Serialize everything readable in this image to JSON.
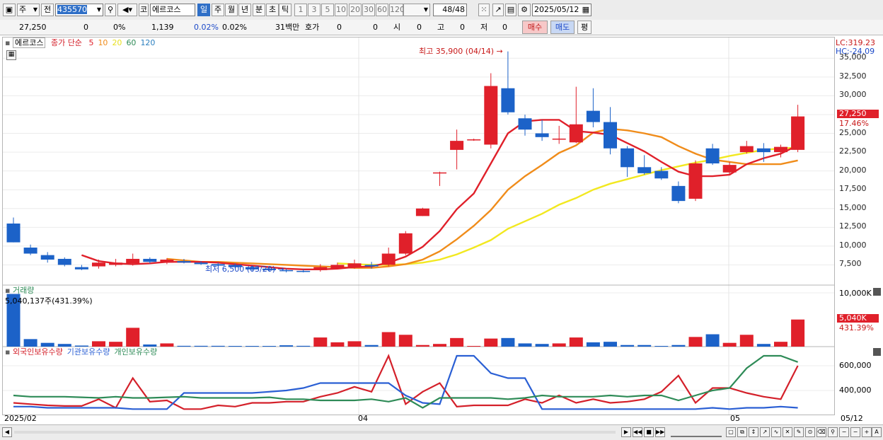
{
  "toolbar": {
    "market_label": "주",
    "all_label": "전",
    "stock_code": "435570",
    "exchange_label": "코",
    "stock_name": "에르코스",
    "period_tabs": [
      "일",
      "주",
      "월",
      "년",
      "분",
      "초",
      "틱"
    ],
    "period_selected": 0,
    "minute_presets": [
      "1",
      "3",
      "5",
      "10",
      "20",
      "30",
      "60",
      "120"
    ],
    "page_count": "48/48",
    "date": "2025/05/12"
  },
  "info": {
    "price": "27,250",
    "change": "0",
    "change_pct": "0%",
    "volume": "1,139",
    "pct1": "0.02%",
    "pct2": "0.02%",
    "amount": "31백만",
    "quote_label": "호가",
    "quote1": "0",
    "quote2": "0",
    "open_label": "시",
    "open_val": "0",
    "high_label": "고",
    "high_val": "0",
    "low_label": "저",
    "low_val": "0",
    "buy_label": "매수",
    "sell_label": "매도",
    "avg_label": "평"
  },
  "price_panel": {
    "legend_name": "에르코스",
    "legend_ma_title": "종가 단순",
    "ma_periods": [
      "5",
      "10",
      "20",
      "60",
      "120"
    ],
    "ma_colors": [
      "#e0202a",
      "#f08c1a",
      "#e8e020",
      "#2e8b57",
      "#2a7fbf"
    ],
    "high_annotation": "최고 35,900 (04/14)",
    "low_annotation": "최저 6,500 (03/20)",
    "lc_label": "LC:319.23",
    "hc_label": "HC:-24.09",
    "current_price_tag": "27,250",
    "current_pct_tag": "17.46%",
    "y_ticks": [
      "35,000",
      "32,500",
      "30,000",
      "27,500",
      "25,000",
      "22,500",
      "20,000",
      "17,500",
      "15,000",
      "12,500",
      "10,000",
      "7,500"
    ]
  },
  "volume_panel": {
    "title": "거래량",
    "current_label": "5,040,137주(431.39%)",
    "max_tick": "10,000K",
    "current_tag": "5,040K",
    "current_pct_tag": "431.39%"
  },
  "holdings_panel": {
    "legend": [
      "외국인보유수량",
      "기관보유수량",
      "개인보유수량"
    ],
    "colors": [
      "#d4202a",
      "#2a5fd4",
      "#2e8b57"
    ],
    "y_ticks": [
      "600,000",
      "400,000"
    ]
  },
  "x_axis": {
    "labels": [
      "2025/02",
      "04",
      "05"
    ],
    "right_label": "05/12"
  },
  "chart_data": {
    "type": "candlestick",
    "ylim": [
      5000,
      37000
    ],
    "candles": [
      {
        "o": 13000,
        "h": 13800,
        "l": 10500,
        "c": 10500
      },
      {
        "o": 9800,
        "h": 10200,
        "l": 8800,
        "c": 9000
      },
      {
        "o": 8800,
        "h": 9200,
        "l": 7800,
        "c": 8200
      },
      {
        "o": 8300,
        "h": 8500,
        "l": 7300,
        "c": 7500
      },
      {
        "o": 7200,
        "h": 7500,
        "l": 6800,
        "c": 6900
      },
      {
        "o": 7300,
        "h": 8200,
        "l": 7000,
        "c": 7800
      },
      {
        "o": 7500,
        "h": 8300,
        "l": 7300,
        "c": 7800
      },
      {
        "o": 7700,
        "h": 9000,
        "l": 7400,
        "c": 8300
      },
      {
        "o": 8300,
        "h": 8500,
        "l": 7700,
        "c": 7900
      },
      {
        "o": 7800,
        "h": 8400,
        "l": 7600,
        "c": 8200
      },
      {
        "o": 8000,
        "h": 8300,
        "l": 7700,
        "c": 7800
      },
      {
        "o": 7800,
        "h": 8000,
        "l": 7500,
        "c": 7600
      },
      {
        "o": 7600,
        "h": 7800,
        "l": 7300,
        "c": 7400
      },
      {
        "o": 7500,
        "h": 7700,
        "l": 7000,
        "c": 7200
      },
      {
        "o": 7200,
        "h": 7400,
        "l": 6700,
        "c": 6900
      },
      {
        "o": 7000,
        "h": 7200,
        "l": 6600,
        "c": 6800
      },
      {
        "o": 6800,
        "h": 7000,
        "l": 6500,
        "c": 6700
      },
      {
        "o": 6700,
        "h": 6900,
        "l": 6500,
        "c": 6600
      },
      {
        "o": 6800,
        "h": 7600,
        "l": 6600,
        "c": 7200
      },
      {
        "o": 7000,
        "h": 7800,
        "l": 6900,
        "c": 7500
      },
      {
        "o": 7200,
        "h": 8200,
        "l": 7000,
        "c": 7700
      },
      {
        "o": 7500,
        "h": 7900,
        "l": 7000,
        "c": 7300
      },
      {
        "o": 7500,
        "h": 9800,
        "l": 7300,
        "c": 9000
      },
      {
        "o": 9000,
        "h": 12000,
        "l": 8800,
        "c": 11700
      },
      {
        "o": 14000,
        "h": 15100,
        "l": 14000,
        "c": 15000
      },
      {
        "o": 19800,
        "h": 19900,
        "l": 18000,
        "c": 19800
      },
      {
        "o": 22800,
        "h": 25500,
        "l": 20200,
        "c": 24000
      },
      {
        "o": 24200,
        "h": 24300,
        "l": 24000,
        "c": 24200
      },
      {
        "o": 23500,
        "h": 33000,
        "l": 23000,
        "c": 31300
      },
      {
        "o": 31000,
        "h": 35900,
        "l": 27500,
        "c": 27800
      },
      {
        "o": 27000,
        "h": 27500,
        "l": 24700,
        "c": 25500
      },
      {
        "o": 25000,
        "h": 26800,
        "l": 24000,
        "c": 24500
      },
      {
        "o": 24300,
        "h": 26000,
        "l": 23600,
        "c": 24300
      },
      {
        "o": 23800,
        "h": 31200,
        "l": 23700,
        "c": 26200
      },
      {
        "o": 28000,
        "h": 31000,
        "l": 25800,
        "c": 26500
      },
      {
        "o": 26500,
        "h": 28500,
        "l": 22200,
        "c": 23000
      },
      {
        "o": 23000,
        "h": 23300,
        "l": 19200,
        "c": 20500
      },
      {
        "o": 20500,
        "h": 22100,
        "l": 19500,
        "c": 19700
      },
      {
        "o": 20000,
        "h": 20500,
        "l": 18800,
        "c": 19000
      },
      {
        "o": 18000,
        "h": 18600,
        "l": 15700,
        "c": 16000
      },
      {
        "o": 16300,
        "h": 21400,
        "l": 16000,
        "c": 21000
      },
      {
        "o": 23000,
        "h": 23600,
        "l": 20800,
        "c": 21000
      },
      {
        "o": 19800,
        "h": 21200,
        "l": 19500,
        "c": 20800
      },
      {
        "o": 22500,
        "h": 24000,
        "l": 22300,
        "c": 23300
      },
      {
        "o": 23000,
        "h": 23700,
        "l": 21200,
        "c": 22500
      },
      {
        "o": 22500,
        "h": 23500,
        "l": 21800,
        "c": 23200
      },
      {
        "o": 22800,
        "h": 28800,
        "l": 22500,
        "c": 27250
      }
    ],
    "volume": [
      9800000,
      1400000,
      700000,
      500000,
      200000,
      1000000,
      900000,
      3500000,
      400000,
      600000,
      150000,
      150000,
      150000,
      120000,
      100000,
      100000,
      250000,
      150000,
      1700000,
      800000,
      1000000,
      300000,
      2700000,
      2200000,
      300000,
      500000,
      1600000,
      100000,
      1500000,
      1600000,
      600000,
      500000,
      600000,
      1700000,
      800000,
      900000,
      300000,
      300000,
      100000,
      300000,
      1800000,
      2300000,
      700000,
      2200000,
      500000,
      900000,
      5040000
    ],
    "ma5": [
      null,
      null,
      null,
      null,
      8800,
      8000,
      7700,
      7600,
      7700,
      7900,
      7900,
      7900,
      7800,
      7600,
      7400,
      7200,
      7000,
      6900,
      6900,
      7000,
      7200,
      7300,
      7800,
      8600,
      9900,
      12000,
      14900,
      17000,
      21000,
      25000,
      26600,
      26800,
      26800,
      25300,
      25100,
      24800,
      23700,
      22600,
      21200,
      19900,
      19300,
      19300,
      19500,
      20900,
      21700,
      22300,
      23400
    ],
    "ma10": [
      null,
      null,
      null,
      null,
      null,
      null,
      null,
      null,
      null,
      8300,
      8100,
      7900,
      7900,
      7800,
      7700,
      7600,
      7500,
      7400,
      7300,
      7200,
      7100,
      7100,
      7300,
      7600,
      8200,
      9300,
      10900,
      12700,
      14800,
      17500,
      19300,
      20800,
      22400,
      23400,
      25100,
      25600,
      25400,
      25000,
      24500,
      23300,
      22300,
      21500,
      21200,
      20900,
      20900,
      20900,
      21400
    ],
    "ma20": [
      null,
      null,
      null,
      null,
      null,
      null,
      null,
      null,
      null,
      null,
      null,
      null,
      null,
      null,
      null,
      null,
      null,
      null,
      null,
      7700,
      7600,
      7500,
      7500,
      7600,
      7800,
      8200,
      8900,
      9800,
      10800,
      12300,
      13300,
      14300,
      15500,
      16400,
      17500,
      18300,
      18900,
      19500,
      20100,
      20600,
      21100,
      21500,
      22000,
      22400,
      22800,
      23000,
      23100
    ],
    "foreign": [
      300000,
      290000,
      280000,
      275000,
      275000,
      330000,
      260000,
      500000,
      310000,
      320000,
      250000,
      250000,
      280000,
      270000,
      300000,
      300000,
      310000,
      310000,
      350000,
      380000,
      430000,
      390000,
      680000,
      290000,
      390000,
      460000,
      270000,
      280000,
      280000,
      280000,
      330000,
      300000,
      360000,
      300000,
      330000,
      300000,
      310000,
      330000,
      390000,
      520000,
      300000,
      420000,
      420000,
      380000,
      350000,
      330000,
      600000
    ],
    "institution": [
      270000,
      270000,
      260000,
      260000,
      260000,
      260000,
      260000,
      250000,
      250000,
      250000,
      380000,
      380000,
      380000,
      380000,
      380000,
      390000,
      400000,
      420000,
      460000,
      460000,
      460000,
      460000,
      460000,
      360000,
      300000,
      290000,
      680000,
      680000,
      540000,
      500000,
      500000,
      250000,
      250000,
      250000,
      250000,
      250000,
      250000,
      250000,
      250000,
      250000,
      250000,
      260000,
      250000,
      260000,
      260000,
      270000,
      260000
    ],
    "individual": [
      360000,
      350000,
      350000,
      350000,
      345000,
      340000,
      350000,
      340000,
      340000,
      345000,
      350000,
      340000,
      340000,
      340000,
      340000,
      345000,
      330000,
      330000,
      320000,
      320000,
      320000,
      330000,
      310000,
      340000,
      260000,
      340000,
      340000,
      340000,
      340000,
      330000,
      340000,
      360000,
      350000,
      350000,
      350000,
      360000,
      350000,
      360000,
      360000,
      320000,
      360000,
      400000,
      420000,
      580000,
      680000,
      680000,
      630000
    ]
  }
}
